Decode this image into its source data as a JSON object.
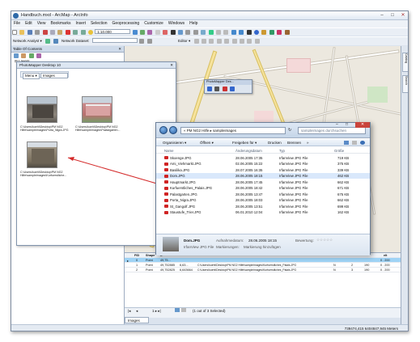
{
  "window": {
    "title": "Handbuch.mxd - ArcMap - ArcInfo"
  },
  "menu": [
    "File",
    "Edit",
    "View",
    "Bookmarks",
    "Insert",
    "Selection",
    "Geoprocessing",
    "Customize",
    "Windows",
    "Help"
  ],
  "toolbar": {
    "scale": "1:10.000",
    "network_analyst": "Network Analyst ▾",
    "network_dataset": "Network Dataset:",
    "editor": "Editor ▾"
  },
  "toc": {
    "title": "Table Of Contents",
    "layers_label": "Layers"
  },
  "photomapper": {
    "title": "PhotoMapper Desktop 10",
    "menu_label": "Menu ▾",
    "view_select": "Images",
    "images": [
      {
        "caption": "C:\\Users\\kuehl\\Desktop\\PM NG2 Hilfe\\sampleimages\\Porta_Nigra.JPG"
      },
      {
        "caption": "C:\\Users\\kuehl\\Desktop\\PM NG2 Hilfe\\sampleimages\\Palastgarten..."
      },
      {
        "caption": "C:\\Users\\kuehl\\Desktop\\PM NG2 Hilfe\\sampleimages\\Kurfuerstliche..."
      }
    ]
  },
  "map_toolbar": {
    "title": "PhotoMapper Des..."
  },
  "explorer": {
    "address": "« PM NG2 Hilfe ▸ sampleimages",
    "search_placeholder": "sampleimages durchsuchen",
    "commands": {
      "organize": "Organisieren ▾",
      "open": "Öffnen ▾",
      "share": "Freigeben für ▾",
      "print": "Drucken",
      "burn": "Brennen",
      "more": "»"
    },
    "columns": {
      "name": "Name",
      "date": "Änderungsdatum",
      "type": "Typ",
      "size": "Größe"
    },
    "files": [
      {
        "name": "Skoenge.JPG",
        "date": "28.06.2005 17:35",
        "type": "IrfanView JPG File",
        "size": "719 KB"
      },
      {
        "name": "Ami_Viehmarkt.JPG",
        "date": "02.06.2005 15:22",
        "type": "IrfanView JPG File",
        "size": "375 KB"
      },
      {
        "name": "Basilika.JPG",
        "date": "28.07.2005 16:35",
        "type": "IrfanView JPG File",
        "size": "339 KB"
      },
      {
        "name": "Dom.JPG",
        "date": "28.06.2005 18:15",
        "type": "IrfanView JPG File",
        "size": "462 KB"
      },
      {
        "name": "Hauptmarkt.JPG",
        "date": "28.06.2005 17:45",
        "type": "IrfanView JPG File",
        "size": "662 KB"
      },
      {
        "name": "Kurfuerstliches_Palais.JPG",
        "date": "28.06.2005 18:42",
        "type": "IrfanView JPG File",
        "size": "671 KB"
      },
      {
        "name": "Palastgarten.JPG",
        "date": "28.06.2005 13:47",
        "type": "IrfanView JPG File",
        "size": "675 KB"
      },
      {
        "name": "Porta_Nigra.JPG",
        "date": "28.06.2005 18:03",
        "type": "IrfanView JPG File",
        "size": "662 KB"
      },
      {
        "name": "St_Gangolf.JPG",
        "date": "28.06.2005 13:51",
        "type": "IrfanView JPG File",
        "size": "699 KB"
      },
      {
        "name": "Staustufe_Trier.JPG",
        "date": "06.01.2010 12:04",
        "type": "IrfanView JPG File",
        "size": "162 KB"
      }
    ],
    "details": {
      "name": "Dom.JPG",
      "type": "IrfanView JPG File",
      "taken_label": "Aufnahmedatum:",
      "taken_value": "28.06.2005 18:15",
      "tags_label": "Markierungen:",
      "tags_value": "Markierung hinzufügen",
      "rating_label": "Bewertung:",
      "rating_stars": "☆☆☆☆☆"
    }
  },
  "attr_table": {
    "columns": [
      "FID",
      "Shape",
      "X",
      "Y",
      "Path",
      "",
      "",
      "",
      "",
      "elt"
    ],
    "rows": [
      {
        "fid": "0",
        "shape": "Point",
        "x": "49,75...",
        "y": "",
        "path": "",
        "c1": "",
        "c2": "",
        "c3": "",
        "end": "0 . 200"
      },
      {
        "fid": "1",
        "shape": "Point",
        "x": "49,752885",
        "y": "6,63...",
        "path": "C:\\Users\\kuehl\\Desktop\\PM NG2 Hilfe\\sampleimages\\Kurfuerstliches_Palais.JPG",
        "c1": "N",
        "c2": "2",
        "c3": "190",
        "end": "0 . 200"
      },
      {
        "fid": "2",
        "shape": "Point",
        "x": "49,752825",
        "y": "6,643664",
        "path": "C:\\Users\\kuehl\\Desktop\\PM NG2 Hilfe\\sampleimages\\Kurfuerstliches_Palais.JPG",
        "c1": "N",
        "c2": "3",
        "c3": "190",
        "end": "0 . 200"
      }
    ],
    "record_nav": "1  ▸  ▸|",
    "selected_count": "(1 out of 3 Selected)",
    "tab_label": "Images"
  },
  "status": {
    "coords": "739474,415  6404847,945 Meters"
  },
  "dock_tabs": {
    "catalog": "Catalog",
    "search": "Search"
  }
}
